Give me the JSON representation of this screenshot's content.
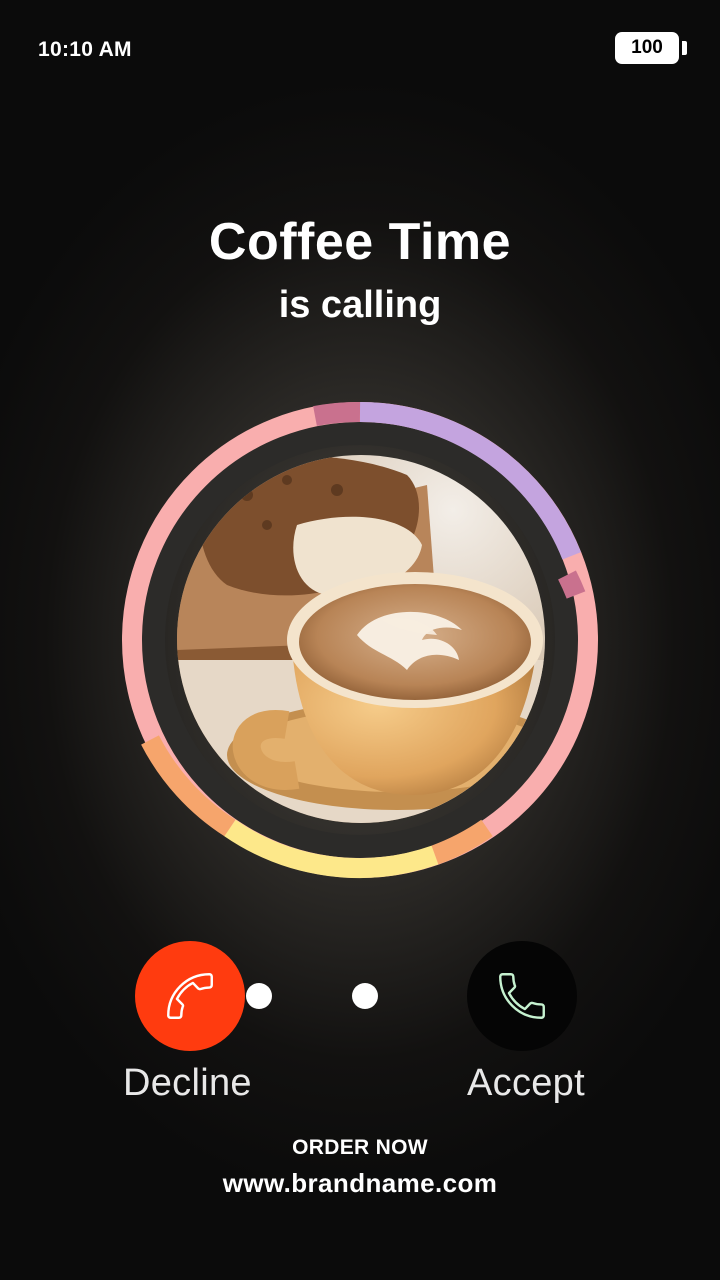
{
  "status_bar": {
    "time": "10:10 AM",
    "battery_level": "100"
  },
  "caller": {
    "name": "Coffee Time",
    "status": "is calling"
  },
  "photo": {
    "subject": "latte-art-coffee-cup-with-pastry"
  },
  "ring_colors": {
    "pink": "#f9aeae",
    "mauve": "#c9718e",
    "lavender": "#c4a4df",
    "orange": "#f6a56c",
    "yellow": "#fde88a"
  },
  "actions": {
    "decline_label": "Decline",
    "accept_label": "Accept",
    "decline_icon": "phone-icon",
    "accept_icon": "phone-icon",
    "decline_color": "#ff3b0f",
    "accept_color": "#050505"
  },
  "footer": {
    "cta": "ORDER NOW",
    "website": "www.brandname.com"
  }
}
